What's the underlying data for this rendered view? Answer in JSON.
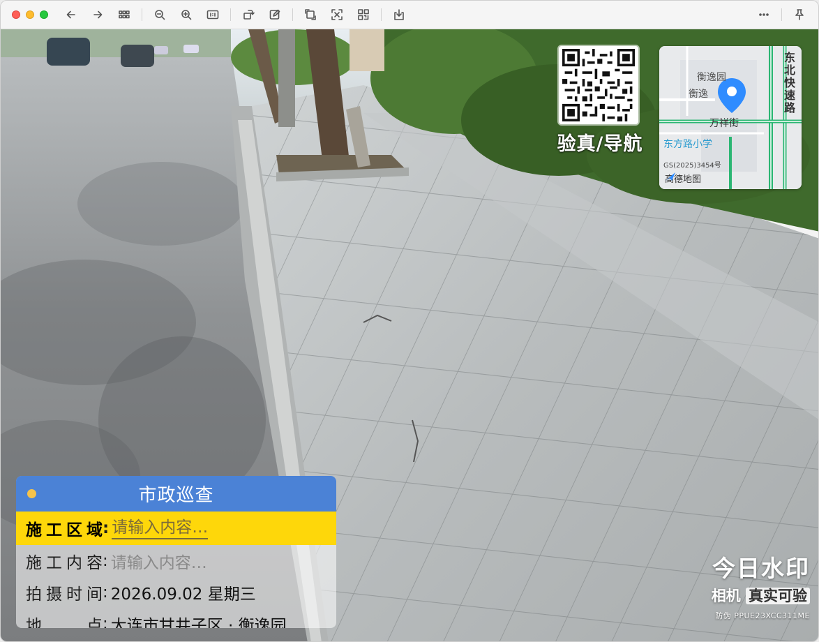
{
  "toolbar": {
    "buttons": [
      {
        "name": "back-button",
        "icon": "arrow-left-icon"
      },
      {
        "name": "forward-button",
        "icon": "arrow-right-icon"
      },
      {
        "name": "thumbnail-grid-button",
        "icon": "grid-icon"
      },
      {
        "name": "zoom-out-button",
        "icon": "zoom-out-icon"
      },
      {
        "name": "zoom-in-button",
        "icon": "zoom-in-icon"
      },
      {
        "name": "actual-size-button",
        "icon": "actual-size-icon"
      },
      {
        "name": "rotate-button",
        "icon": "rotate-icon"
      },
      {
        "name": "markup-button",
        "icon": "pencil-square-icon"
      },
      {
        "name": "crop-button",
        "icon": "crop-icon"
      },
      {
        "name": "text-recognition-button",
        "icon": "scan-text-icon"
      },
      {
        "name": "qr-scan-button",
        "icon": "qr-icon"
      },
      {
        "name": "save-button",
        "icon": "download-icon"
      }
    ],
    "right": [
      {
        "name": "more-button",
        "icon": "ellipsis-icon"
      },
      {
        "name": "pin-button",
        "icon": "pin-icon"
      }
    ]
  },
  "overlay": {
    "qr_caption": "验真/导航",
    "map": {
      "road_vertical": "东北快速路",
      "poi_1": "衡逸园",
      "poi_2": "衡逸",
      "street": "万祥街",
      "school": "东方路小学",
      "gs": "GS(2025)3454号",
      "brand": "高德地图"
    },
    "card": {
      "title": "市政巡查",
      "rows": [
        {
          "label": "施工区域",
          "value": "请输入内容…",
          "type": "placeholder"
        },
        {
          "label": "施工内容",
          "value": "请输入内容…",
          "type": "placeholder"
        },
        {
          "label": "拍摄时间",
          "value": "2026.09.02 星期三",
          "type": "value"
        },
        {
          "label": "地　　点",
          "value": "大连市甘井子区 · 衡逸园",
          "type": "value"
        }
      ]
    },
    "brand": {
      "line1": "今日水印",
      "line2a": "相机",
      "line2b": "真实可验",
      "line3": "防伪 PPUE23XCC311ME"
    }
  },
  "colors": {
    "card_header": "#4b82d6",
    "highlight_row": "#fed70a",
    "map_pin": "#2f8cff"
  }
}
